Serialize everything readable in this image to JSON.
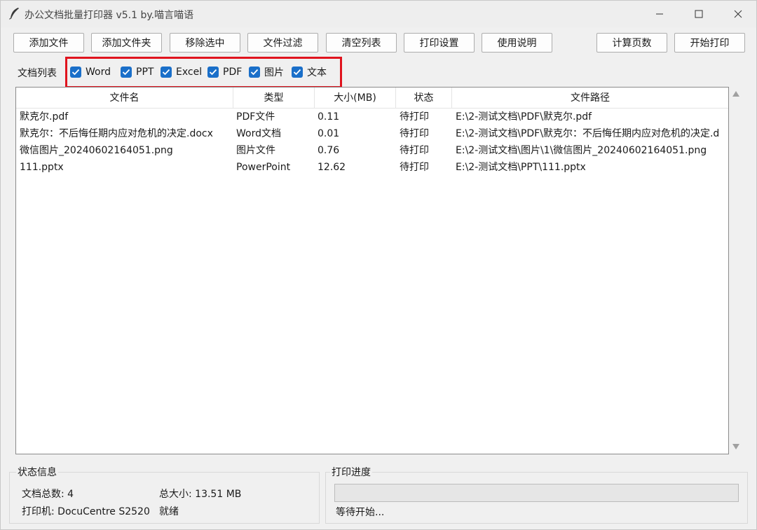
{
  "window": {
    "title": "办公文档批量打印器 v5.1 by.喵言喵语",
    "app_icon": "feather-icon"
  },
  "toolbar": {
    "add_file": "添加文件",
    "add_folder": "添加文件夹",
    "remove_selected": "移除选中",
    "file_filter": "文件过滤",
    "clear_list": "清空列表",
    "print_settings": "打印设置",
    "help": "使用说明",
    "count_pages": "计算页数",
    "start_print": "开始打印"
  },
  "filters": {
    "label": "文档列表",
    "items": [
      {
        "label": "Word",
        "checked": true
      },
      {
        "label": "PPT",
        "checked": true
      },
      {
        "label": "Excel",
        "checked": true
      },
      {
        "label": "PDF",
        "checked": true
      },
      {
        "label": "图片",
        "checked": true
      },
      {
        "label": "文本",
        "checked": true
      }
    ],
    "checkbox_color": "#1a6fc9",
    "highlight_color": "#e0141e"
  },
  "table": {
    "columns": [
      "文件名",
      "类型",
      "大小(MB)",
      "状态",
      "文件路径"
    ],
    "rows": [
      [
        "默克尔.pdf",
        "PDF文件",
        "0.11",
        "待打印",
        "E:\\2-测试文档\\PDF\\默克尔.pdf"
      ],
      [
        "默克尔：不后悔任期内应对危机的决定.docx",
        "Word文档",
        "0.01",
        "待打印",
        "E:\\2-测试文档\\PDF\\默克尔：不后悔任期内应对危机的决定.d"
      ],
      [
        "微信图片_20240602164051.png",
        "图片文件",
        "0.76",
        "待打印",
        "E:\\2-测试文档\\图片\\1\\微信图片_20240602164051.png"
      ],
      [
        "111.pptx",
        "PowerPoint",
        "12.62",
        "待打印",
        "E:\\2-测试文档\\PPT\\111.pptx"
      ]
    ]
  },
  "status": {
    "title": "状态信息",
    "doc_count": "文档总数: 4",
    "total_size": "总大小: 13.51 MB",
    "printer": "打印机: DocuCentre S2520",
    "state": "就绪"
  },
  "progress": {
    "title": "打印进度",
    "value": 0,
    "text": "等待开始..."
  }
}
